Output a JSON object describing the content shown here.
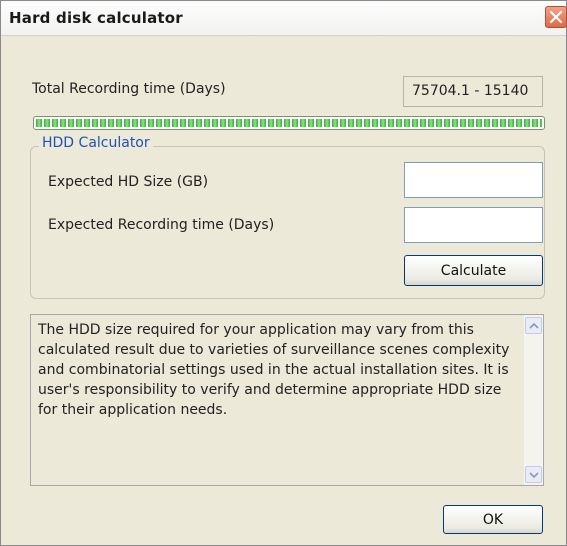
{
  "window": {
    "title": "Hard disk calculator"
  },
  "total_recording": {
    "label": "Total Recording time (Days)",
    "value": "75704.1 - 15140"
  },
  "progress": {
    "fraction": 1.0
  },
  "hdd_calculator": {
    "group_label": "HDD Calculator",
    "hd_size_label": "Expected HD Size (GB)",
    "hd_size_value": "",
    "recording_time_label": "Expected Recording time (Days)",
    "recording_time_value": "",
    "calculate_label": "Calculate"
  },
  "notice": {
    "text": "The HDD size required for your application may vary from this calculated result due to varieties of surveillance scenes complexity and combinatorial settings used in the actual installation sites. It is user's responsibility to verify and determine appropriate HDD size for their application needs."
  },
  "footer": {
    "ok_label": "OK"
  },
  "colors": {
    "dialog_bg": "#ece9d8",
    "group_legend": "#1f52b8",
    "close_button": "#dd6a47",
    "progress_fill": "#33b133"
  },
  "icons": {
    "close": "close-icon",
    "scroll_up": "chevron-up-icon",
    "scroll_down": "chevron-down-icon"
  }
}
